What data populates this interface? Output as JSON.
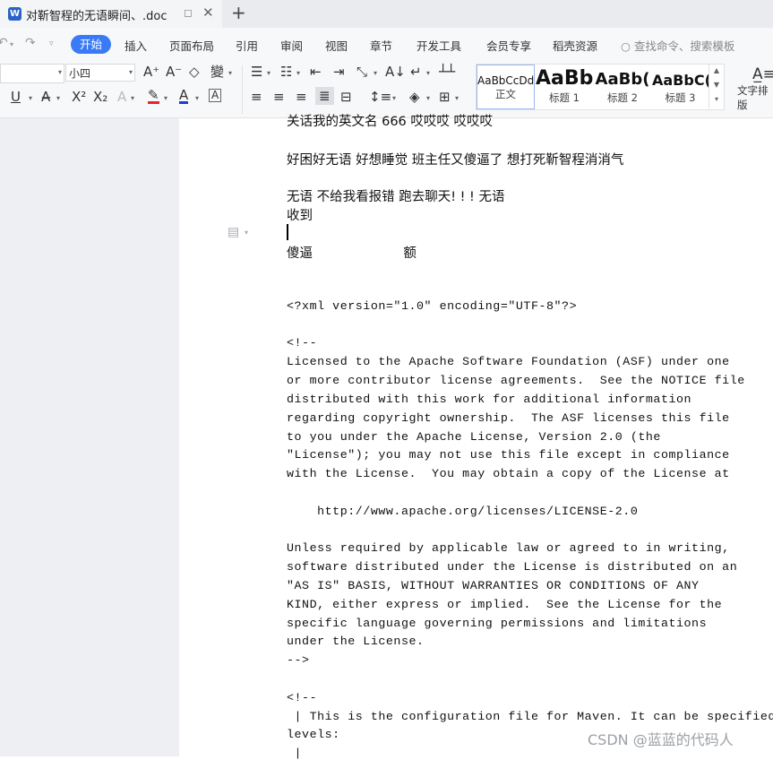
{
  "tab": {
    "app_icon": "W",
    "title": "对靳智程的无语瞬间、.doc",
    "pin_icon": "pin-icon",
    "close_icon": "close-icon"
  },
  "new_tab": "+",
  "menu": {
    "items": [
      "开始",
      "插入",
      "页面布局",
      "引用",
      "审阅",
      "视图",
      "章节",
      "开发工具",
      "会员专享",
      "稻壳资源"
    ],
    "active": "开始",
    "search_placeholder": "查找命令、搜索模板",
    "accent": "#3a7bf5"
  },
  "toolbar": {
    "font_size": "小四",
    "style_gallery": [
      {
        "sample": "AaBbCcDd",
        "label": "正文"
      },
      {
        "sample": "AaBb",
        "label": "标题 1"
      },
      {
        "sample": "AaBb(",
        "label": "标题 2"
      },
      {
        "sample": "AaBbC(",
        "label": "标题 3"
      }
    ],
    "text_layout_label": "文字排版"
  },
  "document": {
    "lines": [
      {
        "text": "关话我的英文名 666 哎哎哎 哎哎哎",
        "style": "cn"
      },
      {
        "text": "好困好无语 好想睡觉 班主任又傻逼了 想打死靳智程消消气",
        "style": "cn"
      },
      {
        "text": "无语 不给我看报错 跑去聊天! ! ! 无语",
        "style": "cn"
      },
      {
        "text": "收到",
        "style": "cn"
      },
      {
        "text": "傻逼                      额",
        "style": "cn"
      },
      {
        "text": "<?xml version=\"1.0\" encoding=\"UTF-8\"?>",
        "style": "mono"
      },
      {
        "text": "<!--",
        "style": "mono"
      },
      {
        "text": "Licensed to the Apache Software Foundation (ASF) under one",
        "style": "mono"
      },
      {
        "text": "or more contributor license agreements.  See the NOTICE file",
        "style": "mono"
      },
      {
        "text": "distributed with this work for additional information",
        "style": "mono"
      },
      {
        "text": "regarding copyright ownership.  The ASF licenses this file",
        "style": "mono"
      },
      {
        "text": "to you under the Apache License, Version 2.0 (the",
        "style": "mono"
      },
      {
        "text": "\"License\"); you may not use this file except in compliance",
        "style": "mono"
      },
      {
        "text": "with the License.  You may obtain a copy of the License at",
        "style": "mono"
      },
      {
        "text": "    http://www.apache.org/licenses/LICENSE-2.0",
        "style": "mono"
      },
      {
        "text": "Unless required by applicable law or agreed to in writing,",
        "style": "mono"
      },
      {
        "text": "software distributed under the License is distributed on an",
        "style": "mono"
      },
      {
        "text": "\"AS IS\" BASIS, WITHOUT WARRANTIES OR CONDITIONS OF ANY",
        "style": "mono"
      },
      {
        "text": "KIND, either express or implied.  See the License for the",
        "style": "mono"
      },
      {
        "text": "specific language governing permissions and limitations",
        "style": "mono"
      },
      {
        "text": "under the License.",
        "style": "mono"
      },
      {
        "text": "-->",
        "style": "mono"
      },
      {
        "text": "<!--",
        "style": "mono"
      },
      {
        "text": " | This is the configuration file for Maven. It can be specified at tw",
        "style": "mono"
      },
      {
        "text": "levels:",
        "style": "mono"
      },
      {
        "text": " |",
        "style": "mono"
      }
    ]
  },
  "watermark": "CSDN @蓝蓝的代码人"
}
